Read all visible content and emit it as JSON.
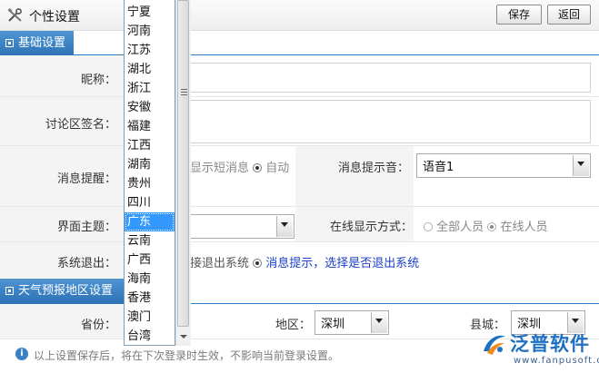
{
  "header": {
    "title": "个性设置",
    "save_label": "保存",
    "back_label": "返回"
  },
  "sections": {
    "basic": "基础设置",
    "weather": "天气预报地区设置"
  },
  "fields": {
    "nickname_label": "昵称：",
    "signature_label": "讨论区签名：",
    "msg_remind_label": "消息提醒：",
    "msg_remind_opt1": "显示短消息",
    "msg_remind_opt2": "自动",
    "msg_sound_label": "消息提示音：",
    "msg_sound_value": "语音1",
    "theme_label": "界面主题：",
    "online_label": "在线显示方式：",
    "online_opt1": "全部人员",
    "online_opt2": "在线人员",
    "exit_label": "系统退出：",
    "exit_opt1": "接退出系统",
    "exit_opt2": "消息提示，选择是否退出系统",
    "province_label": "省份：",
    "region_label": "地区：",
    "region_value": "深圳",
    "county_label": "县城：",
    "county_value": "深圳"
  },
  "province_list": {
    "items": [
      "宁夏",
      "河南",
      "江苏",
      "湖北",
      "浙江",
      "安徽",
      "福建",
      "江西",
      "湖南",
      "贵州",
      "四川",
      "广东",
      "云南",
      "广西",
      "海南",
      "香港",
      "澳门",
      "台湾"
    ],
    "selected": "广东"
  },
  "footer": {
    "note": "以上设置保存后，将在下次登录时生效，不影响当前登录设置。",
    "info_icon": "i",
    "logo_text": "泛普软件",
    "logo_url": "www.fanpusoft.com"
  },
  "colors": {
    "section_blue": "#2d73b6",
    "selected_blue": "#3399ff",
    "logo_blue": "#1e70c1"
  }
}
